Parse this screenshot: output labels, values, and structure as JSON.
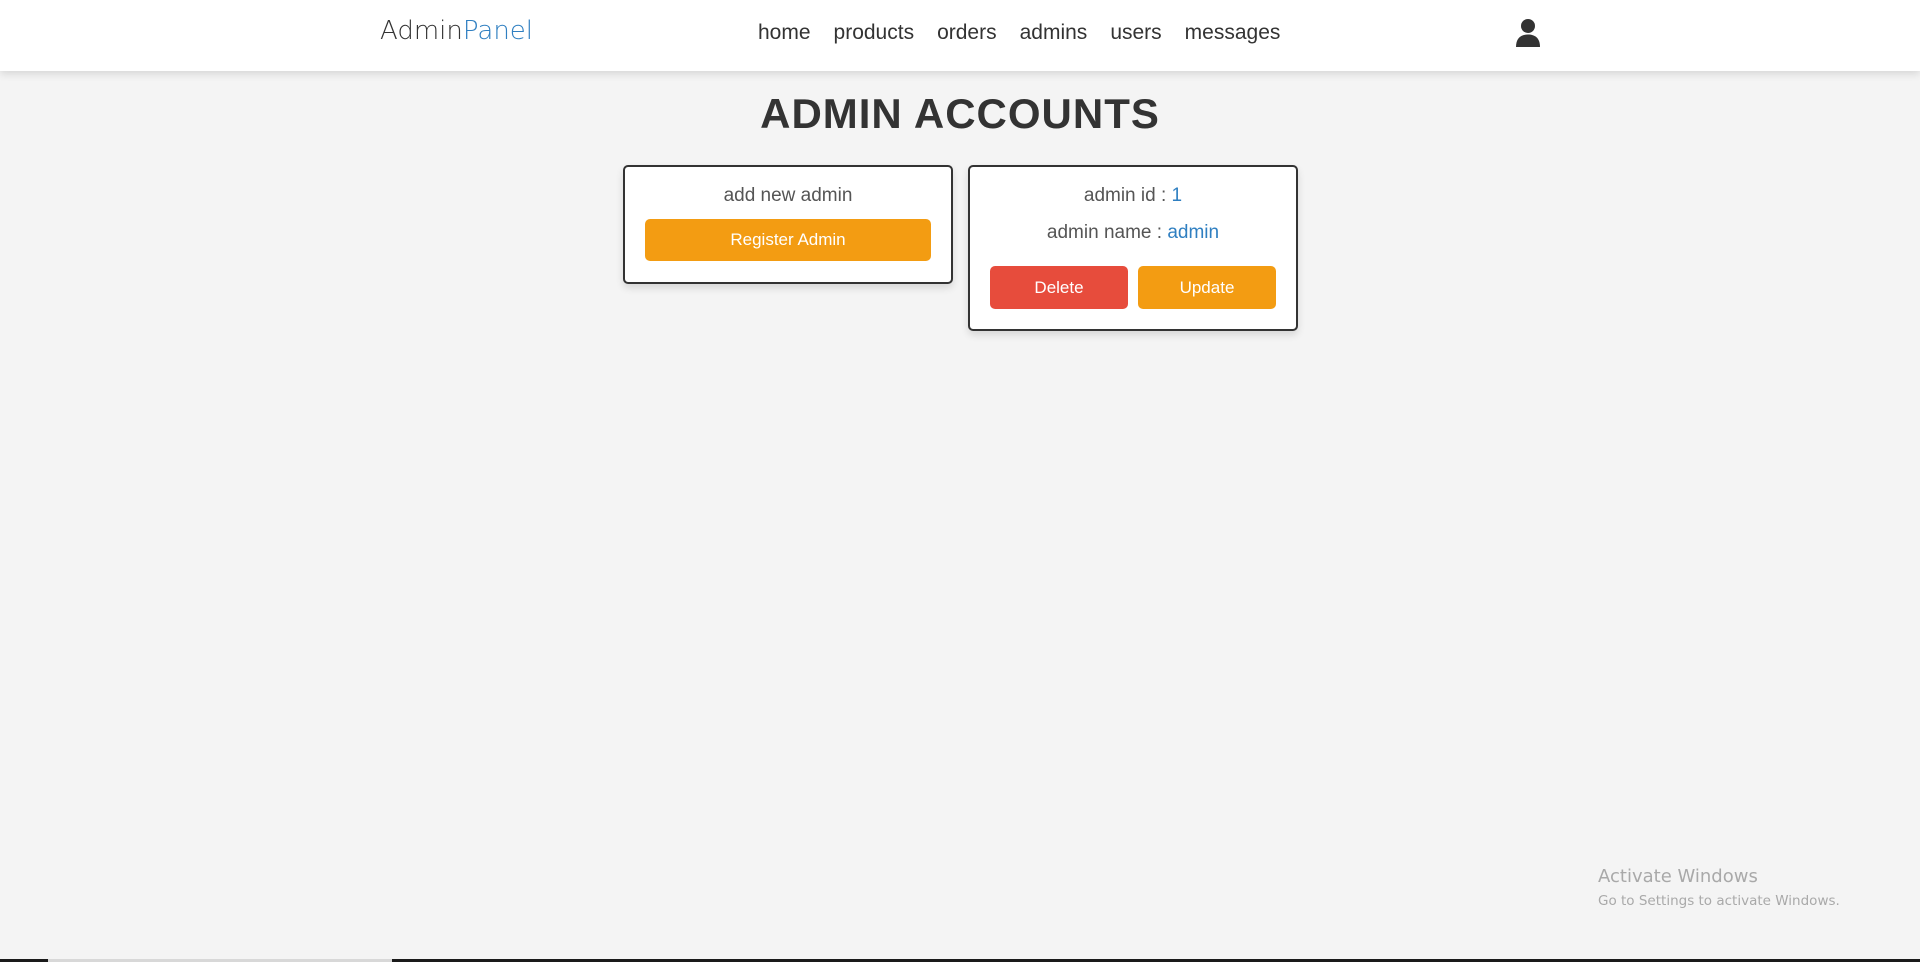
{
  "header": {
    "logo_main": "Admin",
    "logo_accent": "Panel",
    "nav": [
      {
        "label": "home"
      },
      {
        "label": "products"
      },
      {
        "label": "orders"
      },
      {
        "label": "admins"
      },
      {
        "label": "users"
      },
      {
        "label": "messages"
      }
    ],
    "user_icon": "user-icon"
  },
  "page": {
    "title": "ADMIN ACCOUNTS"
  },
  "add_box": {
    "text": "add new admin",
    "register_label": "Register Admin"
  },
  "admin_box": {
    "id_label": "admin id : ",
    "id_value": "1",
    "name_label": "admin name : ",
    "name_value": "admin",
    "delete_label": "Delete",
    "update_label": "Update"
  },
  "watermark": {
    "title": "Activate Windows",
    "subtitle": "Go to Settings to activate Windows."
  },
  "colors": {
    "accent_blue": "#2f7fc1",
    "orange": "#f39c12",
    "red": "#e74c3c",
    "background": "#f4f4f4"
  }
}
